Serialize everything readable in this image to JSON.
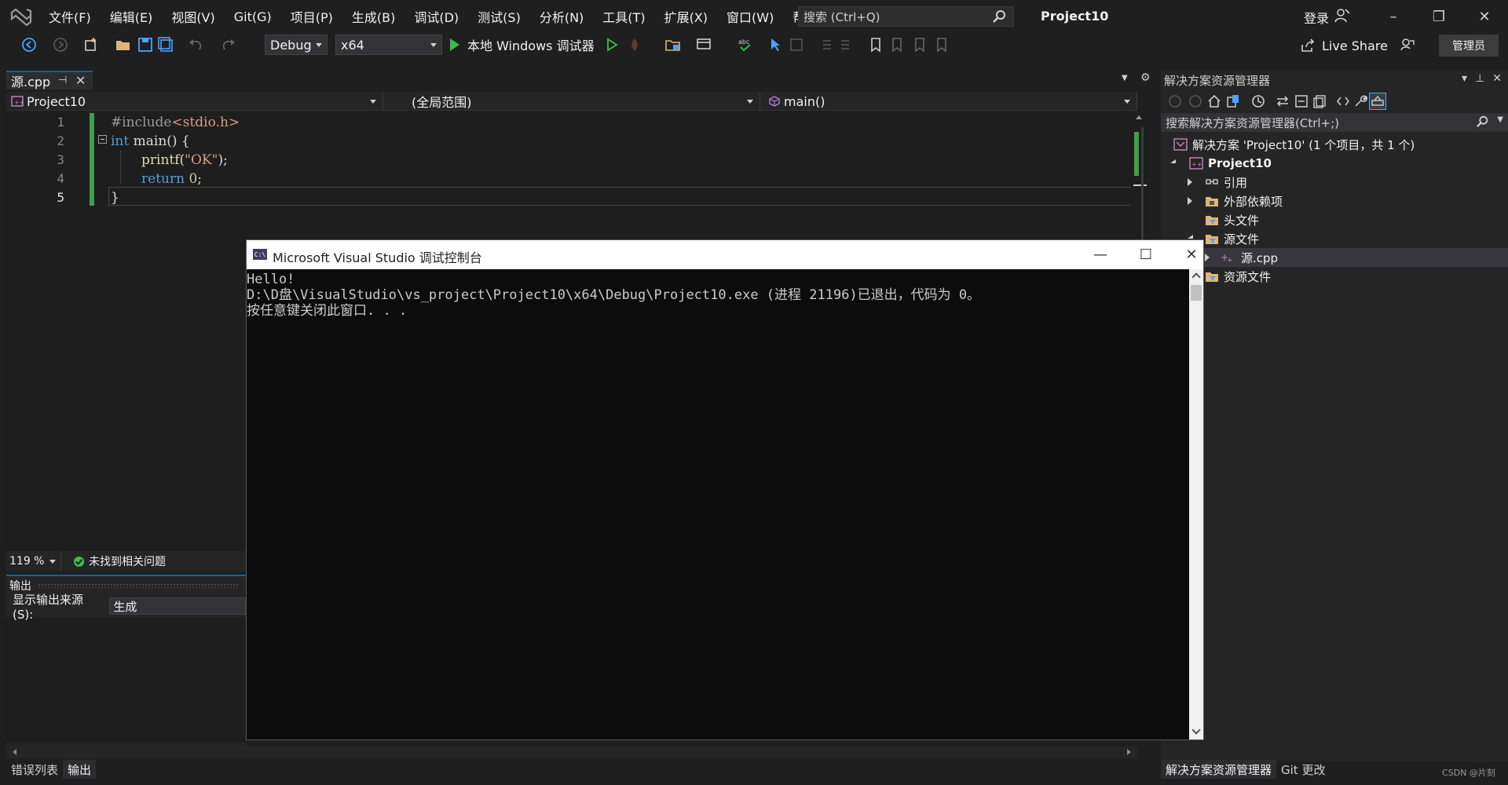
{
  "titlebar": {
    "menu": [
      "文件(F)",
      "编辑(E)",
      "视图(V)",
      "Git(G)",
      "项目(P)",
      "生成(B)",
      "调试(D)",
      "测试(S)",
      "分析(N)",
      "工具(T)",
      "扩展(X)",
      "窗口(W)",
      "帮助(H)"
    ],
    "search_placeholder": "搜索 (Ctrl+Q)",
    "project": "Project10",
    "signin": "登录"
  },
  "toolbar": {
    "config": "Debug",
    "platform": "x64",
    "run_label": "本地 Windows 调试器",
    "live_share": "Live Share",
    "admin": "管理员"
  },
  "editor": {
    "tab": "源.cpp",
    "nav_project": "Project10",
    "nav_scope": "(全局范围)",
    "nav_member": "main()",
    "line_numbers": [
      "1",
      "2",
      "3",
      "4",
      "5"
    ],
    "code": {
      "l1_directive": "#include",
      "l1_header": "<stdio.h>",
      "l2_kw": "int",
      "l2_rest": " main() {",
      "l3_fn": "printf",
      "l3_open": "(",
      "l3_str": "\"OK\"",
      "l3_close": ");",
      "l4_kw": "return",
      "l4_num": "0",
      "l4_end": ";",
      "l5": "}"
    },
    "zoom": "119 %",
    "issues": "未找到相关问题"
  },
  "output": {
    "title": "输出",
    "source_label": "显示输出来源(S):",
    "source_value": "生成"
  },
  "bottom_tabs": [
    "错误列表",
    "输出"
  ],
  "solution_explorer": {
    "title": "解决方案资源管理器",
    "search_placeholder": "搜索解决方案资源管理器(Ctrl+;)",
    "items": [
      "解决方案 'Project10' (1 个项目，共 1 个)",
      "Project10",
      "引用",
      "外部依赖项",
      "头文件",
      "源文件",
      "源.cpp",
      "资源文件"
    ],
    "bottom_tabs": [
      "解决方案资源管理器",
      "Git 更改"
    ]
  },
  "console": {
    "title": "Microsoft Visual Studio 调试控制台",
    "lines": [
      "Hello!",
      "D:\\D盘\\VisualStudio\\vs_project\\Project10\\x64\\Debug\\Project10.exe (进程 21196)已退出，代码为 0。",
      "按任意键关闭此窗口. . ."
    ]
  },
  "watermark": "CSDN @片刻"
}
